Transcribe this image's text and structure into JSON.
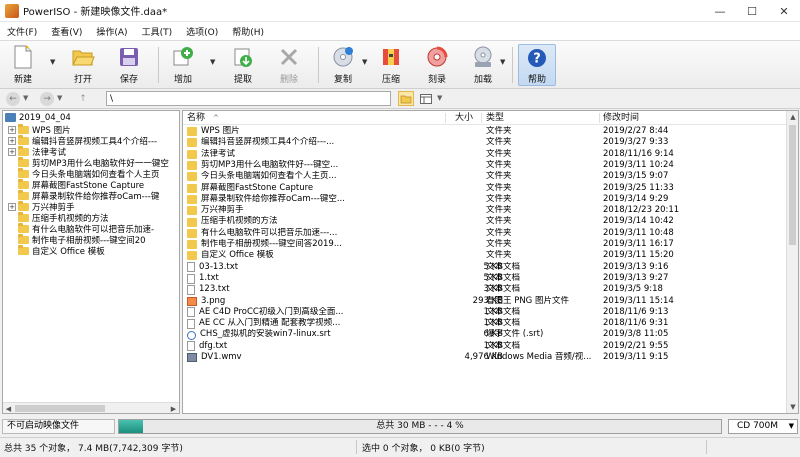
{
  "window": {
    "title": "PowerISO - 新建映像文件.daa*",
    "minimize": "—",
    "maximize": "☐",
    "close": "✕"
  },
  "menu": [
    "文件(F)",
    "查看(V)",
    "操作(A)",
    "工具(T)",
    "选项(O)",
    "帮助(H)"
  ],
  "toolbar": {
    "new": "新建",
    "open": "打开",
    "save": "保存",
    "add": "增加",
    "extract": "提取",
    "delete": "删除",
    "copy": "复制",
    "compress": "压缩",
    "burn": "刻录",
    "mount": "加载",
    "help": "帮助"
  },
  "address": {
    "path": "\\"
  },
  "tree": {
    "root": "2019_04_04",
    "items": [
      {
        "label": "WPS 图片",
        "expand": true
      },
      {
        "label": "编辑抖音竖屏视频工具4个介绍---",
        "expand": true
      },
      {
        "label": "法律考试",
        "expand": true
      },
      {
        "label": "剪切MP3用什么电脑软件好一一键空",
        "expand": false
      },
      {
        "label": "今日头条电脑端如何查看个人主页",
        "expand": false
      },
      {
        "label": "屏幕截图FastStone Capture",
        "expand": false
      },
      {
        "label": "屏幕录制软件给你推荐oCam---键",
        "expand": false
      },
      {
        "label": "万兴神剪手",
        "expand": true
      },
      {
        "label": "压缩手机视频的方法",
        "expand": false
      },
      {
        "label": "有什么电脑软件可以把音乐加速-",
        "expand": false
      },
      {
        "label": "制作电子相册视频---键空间20",
        "expand": false
      },
      {
        "label": "自定义 Office 模板",
        "expand": false
      }
    ]
  },
  "files": {
    "columns": {
      "name": "名称",
      "size": "大小",
      "type": "类型",
      "date": "修改时间"
    },
    "rows": [
      {
        "name": "WPS 图片",
        "size": "",
        "type": "文件夹",
        "date": "2019/2/27 8:44",
        "icon": "folder"
      },
      {
        "name": "编辑抖音竖屏视频工具4个介绍---...",
        "size": "",
        "type": "文件夹",
        "date": "2019/3/27 9:33",
        "icon": "folder"
      },
      {
        "name": "法律考试",
        "size": "",
        "type": "文件夹",
        "date": "2018/11/16 9:14",
        "icon": "folder"
      },
      {
        "name": "剪切MP3用什么电脑软件好---键空...",
        "size": "",
        "type": "文件夹",
        "date": "2019/3/11 10:24",
        "icon": "folder"
      },
      {
        "name": "今日头条电脑端如何查看个人主页...",
        "size": "",
        "type": "文件夹",
        "date": "2019/3/15 9:07",
        "icon": "folder"
      },
      {
        "name": "屏幕截图FastStone Capture",
        "size": "",
        "type": "文件夹",
        "date": "2019/3/25 11:33",
        "icon": "folder"
      },
      {
        "name": "屏幕录制软件给你推荐oCam---键空...",
        "size": "",
        "type": "文件夹",
        "date": "2019/3/14 9:29",
        "icon": "folder"
      },
      {
        "name": "万兴神剪手",
        "size": "",
        "type": "文件夹",
        "date": "2018/12/23 20:11",
        "icon": "folder"
      },
      {
        "name": "压缩手机视频的方法",
        "size": "",
        "type": "文件夹",
        "date": "2019/3/14 10:42",
        "icon": "folder"
      },
      {
        "name": "有什么电脑软件可以把音乐加速---...",
        "size": "",
        "type": "文件夹",
        "date": "2019/3/11 10:48",
        "icon": "folder"
      },
      {
        "name": "制作电子相册视频---键空间答2019...",
        "size": "",
        "type": "文件夹",
        "date": "2019/3/11 16:17",
        "icon": "folder"
      },
      {
        "name": "自定义 Office 模板",
        "size": "",
        "type": "文件夹",
        "date": "2019/3/11 15:20",
        "icon": "folder"
      },
      {
        "name": "03-13.txt",
        "size": "5 KB",
        "type": "文本文档",
        "date": "2019/3/13 9:16",
        "icon": "doc"
      },
      {
        "name": "1.txt",
        "size": "5 KB",
        "type": "文本文档",
        "date": "2019/3/13 9:27",
        "icon": "doc"
      },
      {
        "name": "123.txt",
        "size": "3 KB",
        "type": "文本文档",
        "date": "2019/3/5 9:18",
        "icon": "doc"
      },
      {
        "name": "3.png",
        "size": "293 KB",
        "type": "看图王 PNG 图片文件",
        "date": "2019/3/11 15:14",
        "icon": "png"
      },
      {
        "name": "AE C4D ProCC初级入门到高级全面...",
        "size": "1 KB",
        "type": "文本文档",
        "date": "2018/11/6 9:13",
        "icon": "doc"
      },
      {
        "name": "AE CC 从入门到精通 配套教学视频...",
        "size": "1 KB",
        "type": "文本文档",
        "date": "2018/11/6 9:31",
        "icon": "doc"
      },
      {
        "name": "CHS_虚拟机的安装win7-linux.srt",
        "size": "6 KB",
        "type": "爆字文件 (.srt)",
        "date": "2019/3/8 11:05",
        "icon": "srt"
      },
      {
        "name": "dfg.txt",
        "size": "1 KB",
        "type": "文本文档",
        "date": "2019/2/21 9:55",
        "icon": "doc"
      },
      {
        "name": "DV1.wmv",
        "size": "4,976 KB",
        "type": "Windows Media 音频/视...",
        "date": "2019/3/11 9:15",
        "icon": "wmv"
      }
    ]
  },
  "status": {
    "message": "不可启动映像文件",
    "progress_text": "总共 30 MB  - - - 4 %",
    "progress_percent": 4,
    "disc": "CD 700M",
    "total": "总共 35 个对象，  7.4 MB(7,742,309 字节)",
    "selected": "选中 0 个对象，  0 KB(0 字节)"
  },
  "colors": {
    "progress": "#1c8f7e",
    "folder": "#f2c94c",
    "active_button": "#c3d9f1"
  }
}
